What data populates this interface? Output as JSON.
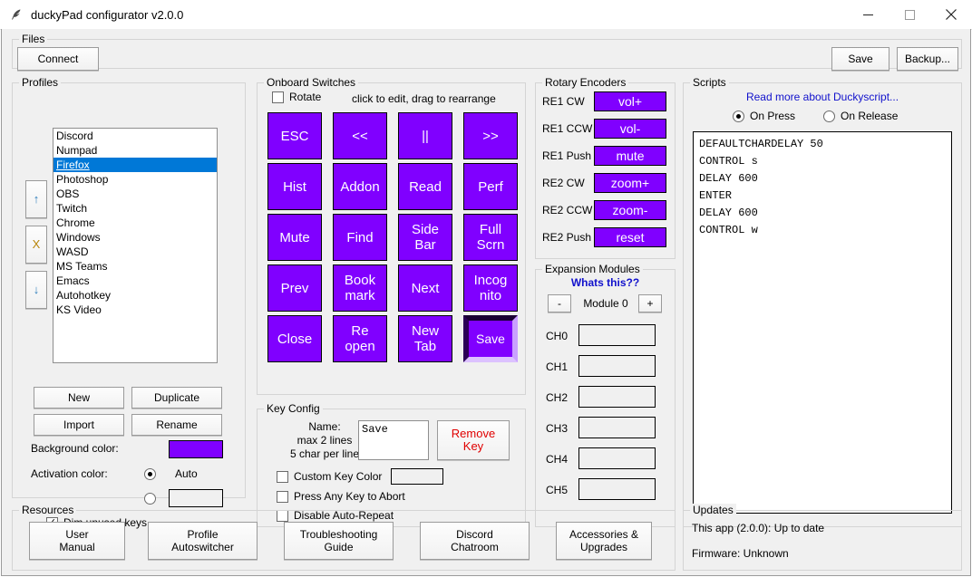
{
  "window": {
    "title": "duckyPad configurator v2.0.0",
    "icon": "feather-icon",
    "minimize": "minimize-icon",
    "maximize": "maximize-icon",
    "close": "close-icon"
  },
  "files": {
    "group_title": "Files",
    "connect_label": "Connect",
    "save_label": "Save",
    "backup_label": "Backup..."
  },
  "profiles": {
    "group_title": "Profiles",
    "items": [
      "Discord",
      "Numpad",
      "Firefox",
      "Photoshop",
      "OBS",
      "Twitch",
      "Chrome",
      "Windows",
      "WASD",
      "MS Teams",
      "Emacs",
      "Autohotkey",
      "KS Video"
    ],
    "selected_index": 2,
    "move_up": "↑",
    "delete": "X",
    "move_down": "↓",
    "new_label": "New",
    "duplicate_label": "Duplicate",
    "import_label": "Import",
    "rename_label": "Rename",
    "background_color_label": "Background color:",
    "background_color_value": "#8000ff",
    "activation_color_label": "Activation color:",
    "activation_auto_label": "Auto",
    "activation_mode": "auto",
    "activation_custom_value": "",
    "dim_unused_label": "Dim unused keys",
    "dim_unused_checked": true
  },
  "onboard": {
    "group_title": "Onboard Switches",
    "rotate_label": "Rotate",
    "rotate_checked": false,
    "hint": "click to edit, drag to rearrange",
    "keys": [
      "ESC",
      "<<",
      "||",
      ">>",
      "Hist",
      "Addon",
      "Read",
      "Perf",
      "Mute",
      "Find",
      "Side\nBar",
      "Full\nScrn",
      "Prev",
      "Book\nmark",
      "Next",
      "Incog\nnito",
      "Close",
      "Re\nopen",
      "New\nTab",
      "Save"
    ],
    "selected_key_index": 19,
    "key_color": "#8000ff"
  },
  "key_config": {
    "group_title": "Key Config",
    "name_label_line1": "Name:",
    "name_label_line2": "max 2 lines",
    "name_label_line3": "5 char per line",
    "name_value": "Save",
    "remove_key_label": "Remove\nKey",
    "remove_key_color": "#e00000",
    "custom_key_color_label": "Custom Key Color",
    "custom_key_color_checked": false,
    "custom_key_color_value": "",
    "press_any_key_label": "Press Any Key to Abort",
    "press_any_key_checked": false,
    "disable_autorepeat_label": "Disable Auto-Repeat",
    "disable_autorepeat_checked": false
  },
  "rotary": {
    "group_title": "Rotary Encoders",
    "rows": [
      {
        "label": "RE1 CW",
        "value": "vol+"
      },
      {
        "label": "RE1 CCW",
        "value": "vol-"
      },
      {
        "label": "RE1 Push",
        "value": "mute"
      },
      {
        "label": "RE2 CW",
        "value": "zoom+"
      },
      {
        "label": "RE2 CCW",
        "value": "zoom-"
      },
      {
        "label": "RE2 Push",
        "value": "reset"
      }
    ]
  },
  "expansion": {
    "group_title": "Expansion Modules",
    "help_link": "Whats this??",
    "minus_label": "-",
    "module_label": "Module 0",
    "plus_label": "+",
    "channels": [
      {
        "label": "CH0",
        "value": ""
      },
      {
        "label": "CH1",
        "value": ""
      },
      {
        "label": "CH2",
        "value": ""
      },
      {
        "label": "CH3",
        "value": ""
      },
      {
        "label": "CH4",
        "value": ""
      },
      {
        "label": "CH5",
        "value": ""
      }
    ]
  },
  "scripts": {
    "group_title": "Scripts",
    "help_link": "Read more about Duckyscript...",
    "on_press_label": "On Press",
    "on_release_label": "On Release",
    "trigger_mode": "on_press",
    "content": "DEFAULTCHARDELAY 50\nCONTROL s\nDELAY 600\nENTER\nDELAY 600\nCONTROL w"
  },
  "resources": {
    "group_title": "Resources",
    "buttons": [
      "User\nManual",
      "Profile\nAutoswitcher",
      "Troubleshooting\nGuide",
      "Discord\nChatroom",
      "Accessories &\nUpgrades"
    ]
  },
  "updates": {
    "group_title": "Updates",
    "app_status": "This app (2.0.0): Up to date",
    "firmware_status": "Firmware: Unknown"
  }
}
